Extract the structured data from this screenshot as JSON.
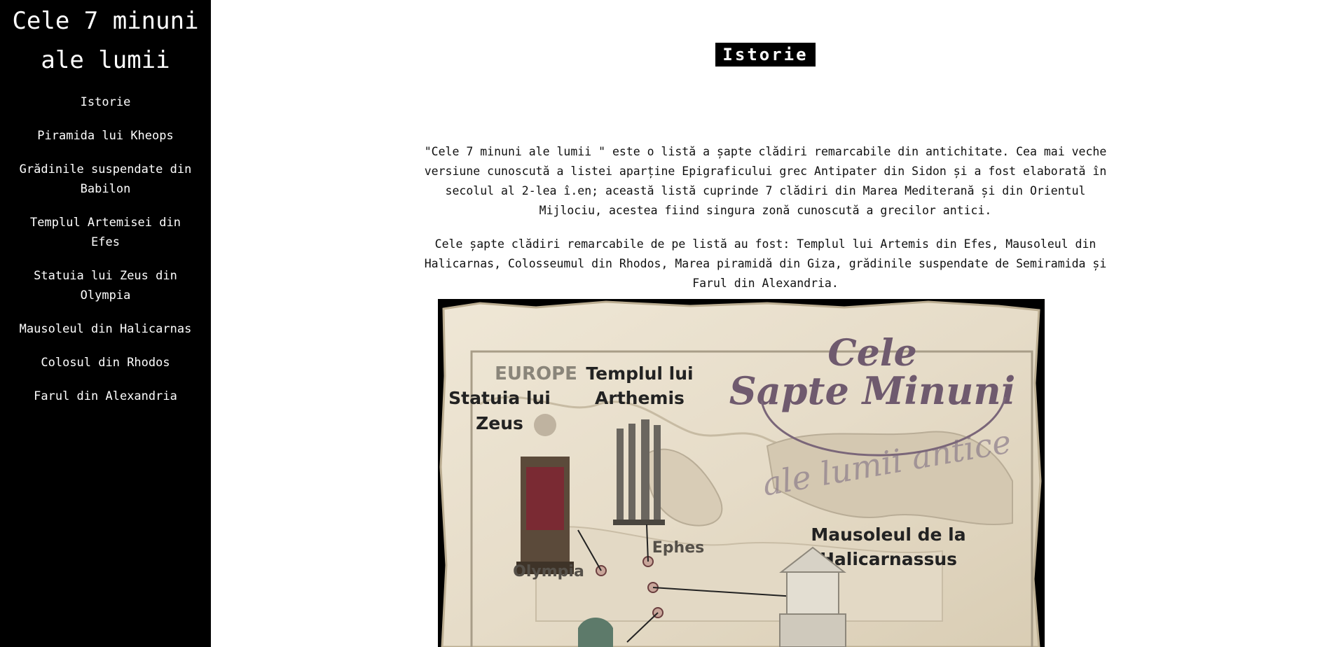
{
  "sidebar": {
    "title": "Cele 7 minuni ale lumii",
    "items": [
      {
        "label": "Istorie"
      },
      {
        "label": "Piramida lui Kheops"
      },
      {
        "label": "Grădinile suspendate din Babilon"
      },
      {
        "label": "Templul Artemisei din Efes"
      },
      {
        "label": "Statuia lui Zeus din Olympia"
      },
      {
        "label": "Mausoleul din Halicarnas"
      },
      {
        "label": "Colosul din Rhodos"
      },
      {
        "label": "Farul din Alexandria"
      }
    ]
  },
  "main": {
    "heading": "Istorie",
    "paragraphs": [
      "\"Cele 7 minuni ale lumii \" este o listă a șapte clădiri remarcabile din antichitate. Cea mai veche versiune cunoscută a listei aparține Epigraficului grec Antipater din Sidon și a fost elaborată în secolul al 2-lea î.en; această listă cuprinde 7 clădiri din Marea Mediterană și din Orientul Mijlociu, acestea fiind singura zonă cunoscută a grecilor antici.",
      "Cele șapte clădiri remarcabile de pe listă au fost: Templul lui Artemis din Efes, Mausoleul din Halicarnas, Colosseumul din Rhodos, Marea piramidă din Giza, grădinile suspendate de Semiramida și Farul din Alexandria."
    ],
    "image": {
      "title_line1": "Cele",
      "title_line2": "Sapte Minuni",
      "title_line3": "ale lumii antice",
      "region": "EUROPE",
      "zeus_line1": "Statuia lui",
      "zeus_line2": "Zeus",
      "temple_line1": "Templul lui",
      "temple_line2": "Arthemis",
      "olympia": "Olympia",
      "ephes": "Ephes",
      "mausoleum_line1": "Mausoleul de la",
      "mausoleum_line2": "Halicarnassus"
    }
  },
  "colors": {
    "sidebar_bg": "#000000",
    "text_light": "#ffffff",
    "parchment": "#e9e0cf",
    "title_purple": "#6f5a6e"
  }
}
